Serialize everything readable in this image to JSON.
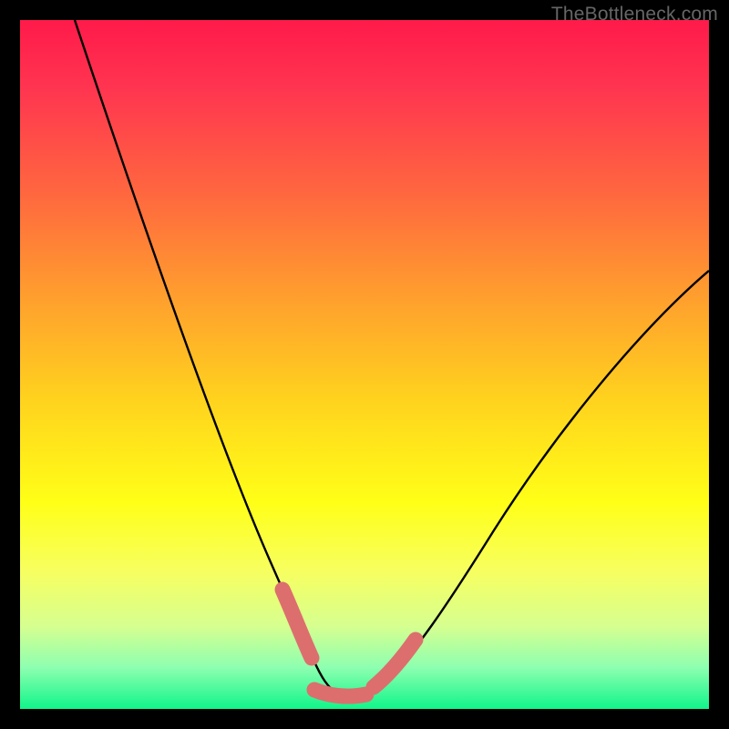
{
  "watermark": "TheBottleneck.com",
  "chart_data": {
    "type": "line",
    "title": "",
    "xlabel": "",
    "ylabel": "",
    "xlim": [
      0,
      100
    ],
    "ylim": [
      0,
      100
    ],
    "series": [
      {
        "name": "bottleneck-curve",
        "x": [
          8,
          12,
          16,
          20,
          24,
          28,
          32,
          36,
          38,
          40,
          42,
          44,
          46,
          48,
          50,
          54,
          60,
          68,
          76,
          84,
          92,
          100
        ],
        "values": [
          100,
          88,
          78,
          68,
          58,
          48,
          38,
          26,
          20,
          14,
          8,
          4,
          2,
          2,
          3,
          7,
          15,
          26,
          37,
          47,
          56,
          64
        ]
      }
    ],
    "annotations": [
      {
        "name": "left-highlight",
        "type": "pink-stroke"
      },
      {
        "name": "bottom-highlight",
        "type": "pink-stroke"
      },
      {
        "name": "right-highlight",
        "type": "pink-stroke"
      }
    ],
    "colors": {
      "curve": "#000000",
      "highlight": "#e06a6a",
      "gradient_top": "#ff1a4a",
      "gradient_bottom": "#10f58a"
    }
  }
}
